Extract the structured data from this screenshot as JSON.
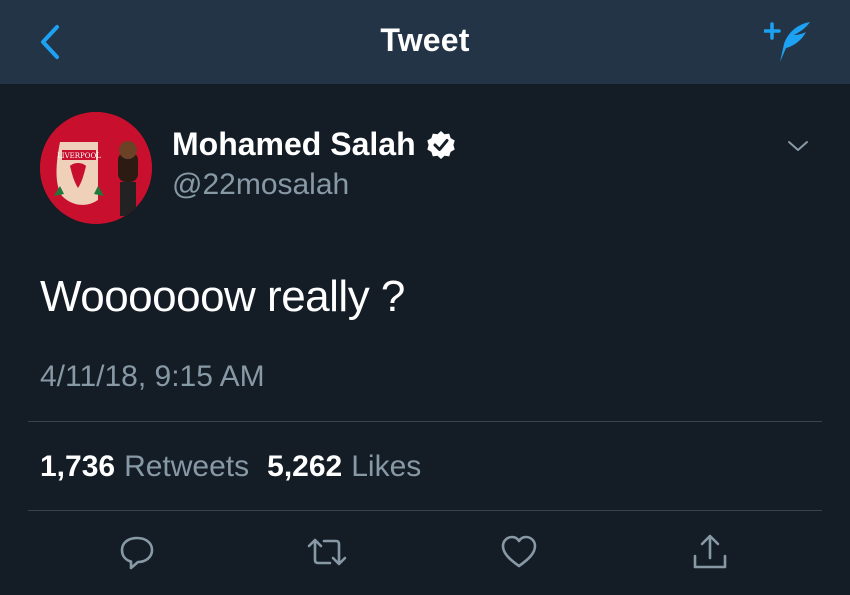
{
  "header": {
    "title": "Tweet",
    "back_icon": "chevron-left-icon",
    "compose_icon": "compose-tweet-icon"
  },
  "tweet": {
    "author": {
      "name": "Mohamed Salah",
      "handle": "@22mosalah",
      "verified": true,
      "avatar_badge_text": "LIVERPOOL"
    },
    "text": "Woooooow really ?",
    "timestamp": "4/11/18, 9:15 AM",
    "stats": {
      "retweets_count": "1,736",
      "retweets_label": "Retweets",
      "likes_count": "5,262",
      "likes_label": "Likes"
    }
  },
  "actions": [
    {
      "name": "reply",
      "icon": "reply-icon"
    },
    {
      "name": "retweet",
      "icon": "retweet-icon"
    },
    {
      "name": "like",
      "icon": "heart-icon"
    },
    {
      "name": "share",
      "icon": "share-icon"
    }
  ],
  "colors": {
    "background": "#141d26",
    "header": "#243447",
    "accent": "#1da1f2",
    "secondary_text": "#8899a6",
    "divider": "#38444d"
  }
}
